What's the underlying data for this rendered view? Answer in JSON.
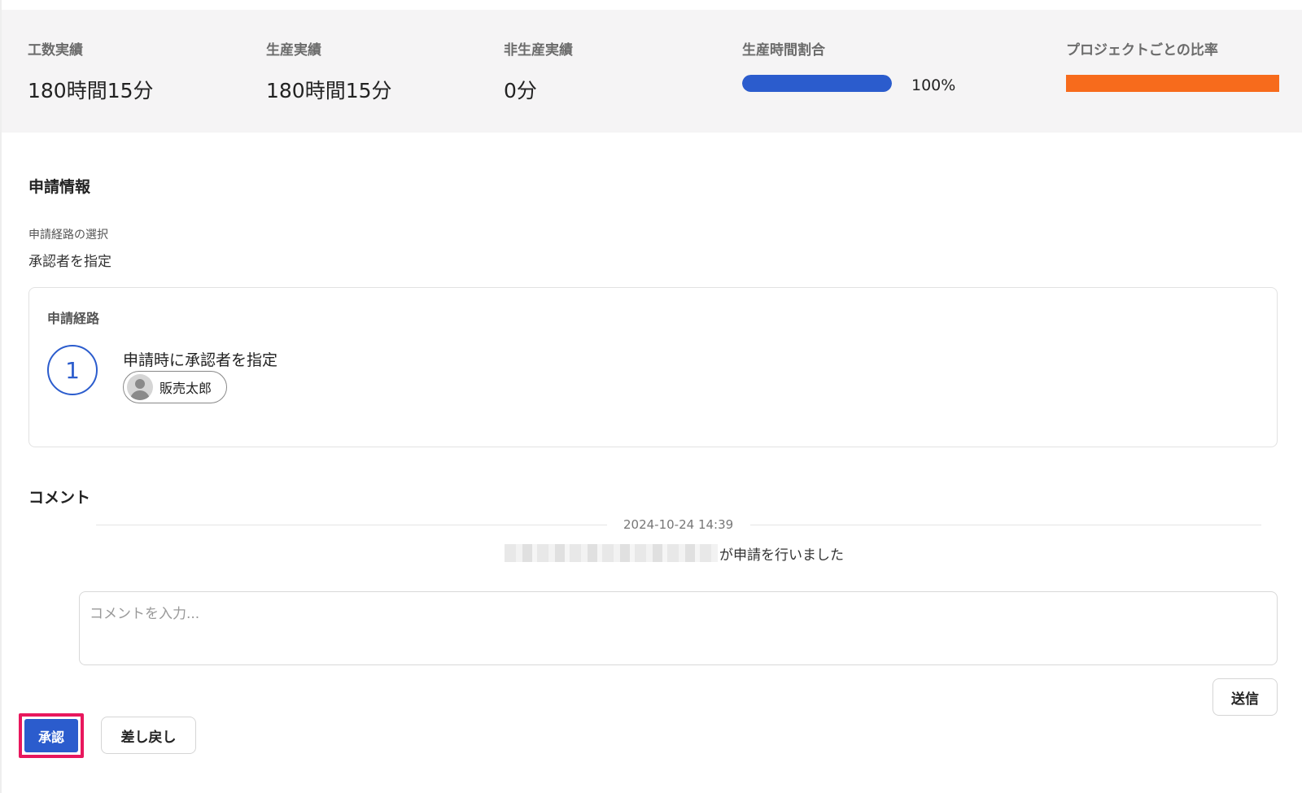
{
  "summary": {
    "work_hours": {
      "label": "工数実績",
      "value": "180時間15分"
    },
    "productive": {
      "label": "生産実績",
      "value": "180時間15分"
    },
    "non_productive": {
      "label": "非生産実績",
      "value": "0分"
    },
    "productive_ratio": {
      "label": "生産時間割合",
      "percent": 100,
      "percent_text": "100%",
      "bar_color": "#2b5ccd"
    },
    "project_ratio": {
      "label": "プロジェクトごとの比率",
      "segments": [
        {
          "share": 1.0,
          "color": "#f76b1c"
        }
      ]
    }
  },
  "application_info": {
    "title": "申請情報",
    "route_select_label": "申請経路の選択",
    "route_select_value": "承認者を指定"
  },
  "route_card": {
    "title": "申請経路",
    "step_number": "1",
    "step_text": "申請時に承認者を指定",
    "approver_name": "販売太郎",
    "approver_icon": "user-avatar-icon"
  },
  "comments": {
    "title": "コメント",
    "timestamp": "2024-10-24 14:39",
    "activity_text": "が申請を行いました",
    "input_placeholder": "コメントを入力...",
    "input_value": "",
    "send_label": "送信"
  },
  "actions": {
    "approve_label": "承認",
    "return_label": "差し戻し",
    "highlight_color": "#e8175d",
    "accent_color": "#2b5ccd"
  }
}
